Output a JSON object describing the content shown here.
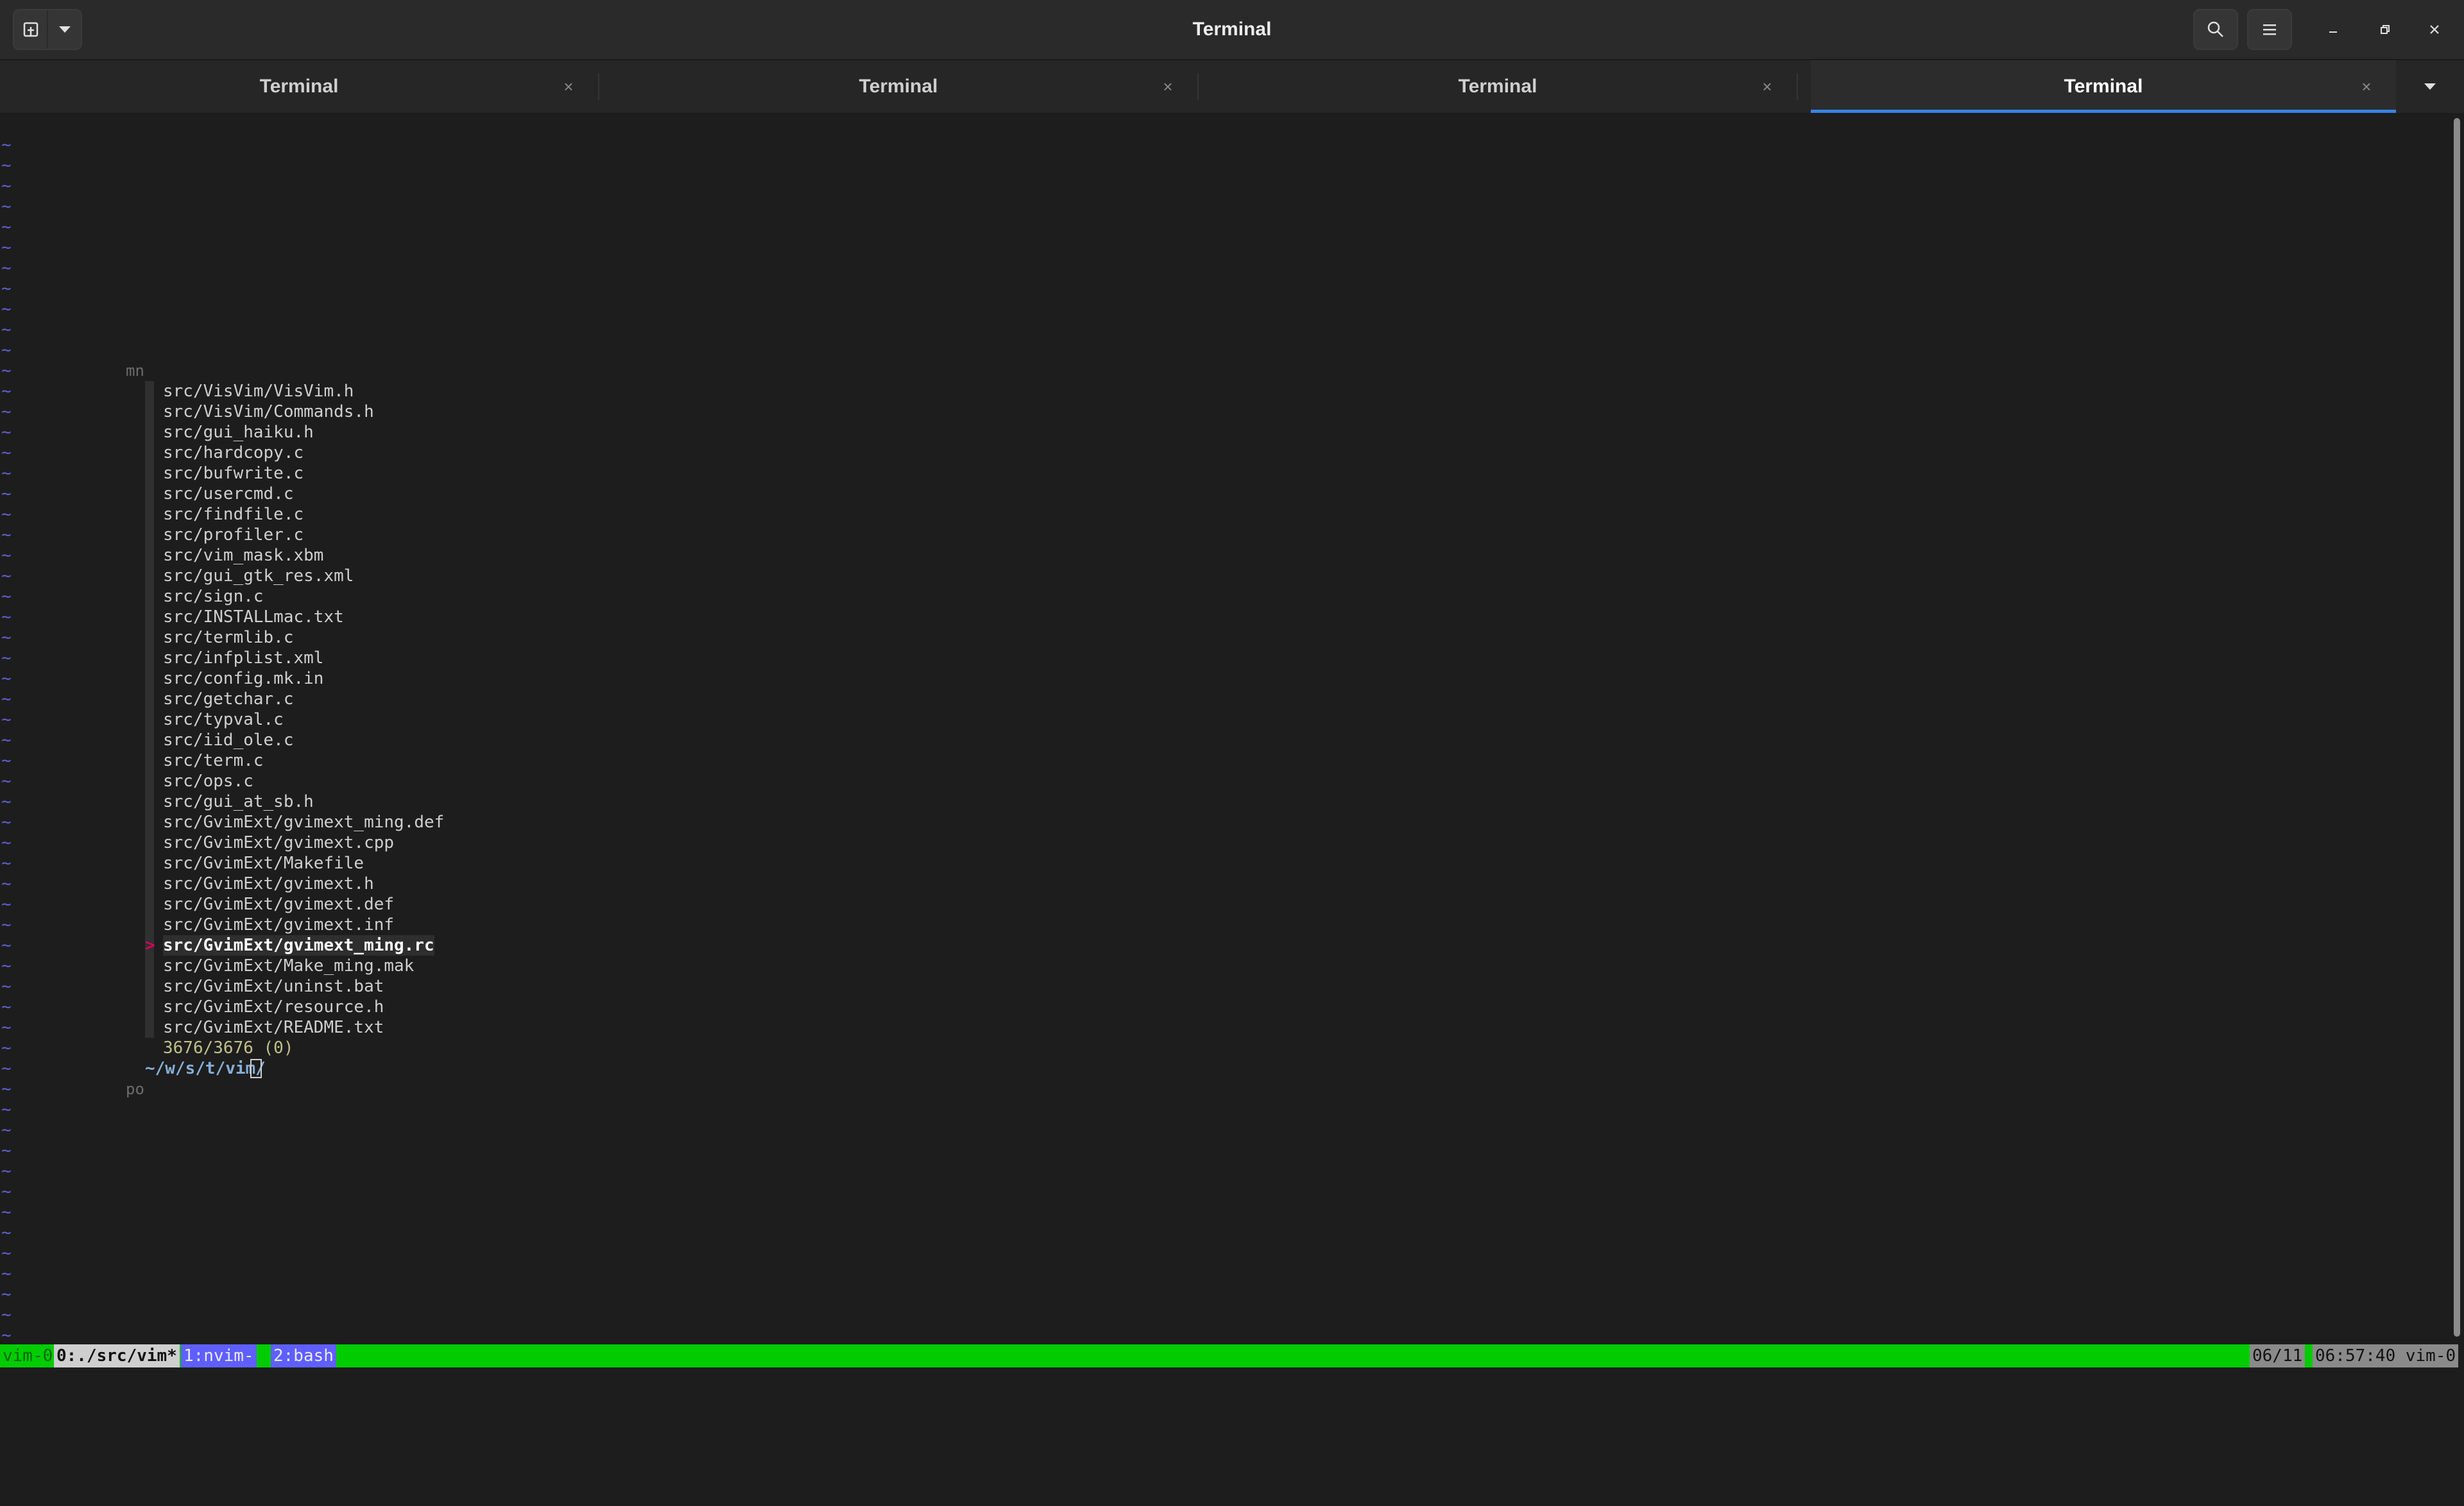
{
  "window": {
    "title": "Terminal",
    "new_tab_icon": "new-tab-icon",
    "dropdown_icon": "chevron-down-icon",
    "search_icon": "search-icon",
    "menu_icon": "hamburger-menu-icon",
    "minimize_icon": "minimize-icon",
    "maximize_icon": "restore-icon",
    "close_icon": "close-icon"
  },
  "tabs": [
    {
      "label": "Terminal",
      "active": false
    },
    {
      "label": "Terminal",
      "active": false
    },
    {
      "label": "Terminal",
      "active": false
    },
    {
      "label": "Terminal",
      "active": true
    }
  ],
  "tab_close_glyph": "×",
  "terminal": {
    "tilde": "~",
    "marker_top": "mn",
    "marker_bottom": "po",
    "files": [
      "src/VisVim/VisVim.h",
      "src/VisVim/Commands.h",
      "src/gui_haiku.h",
      "src/hardcopy.c",
      "src/bufwrite.c",
      "src/usercmd.c",
      "src/findfile.c",
      "src/profiler.c",
      "src/vim_mask.xbm",
      "src/gui_gtk_res.xml",
      "src/sign.c",
      "src/INSTALLmac.txt",
      "src/termlib.c",
      "src/infplist.xml",
      "src/config.mk.in",
      "src/getchar.c",
      "src/typval.c",
      "src/iid_ole.c",
      "src/term.c",
      "src/ops.c",
      "src/gui_at_sb.h",
      "src/GvimExt/gvimext_ming.def",
      "src/GvimExt/gvimext.cpp",
      "src/GvimExt/Makefile",
      "src/GvimExt/gvimext.h",
      "src/GvimExt/gvimext.def",
      "src/GvimExt/gvimext.inf",
      "src/GvimExt/gvimext_ming.rc",
      "src/GvimExt/Make_ming.mak",
      "src/GvimExt/uninst.bat",
      "src/GvimExt/resource.h",
      "src/GvimExt/README.txt"
    ],
    "selected_index": 27,
    "pointer": ">",
    "match_info": "3676/3676 (0)",
    "prompt": "~/w/s/t/vim/"
  },
  "tmux": {
    "session": "vim-0",
    "windows": [
      "0:./src/vim*",
      "1:nvim-",
      "2:bash"
    ],
    "date": "06/11",
    "time": "06:57:40 vim-0"
  }
}
